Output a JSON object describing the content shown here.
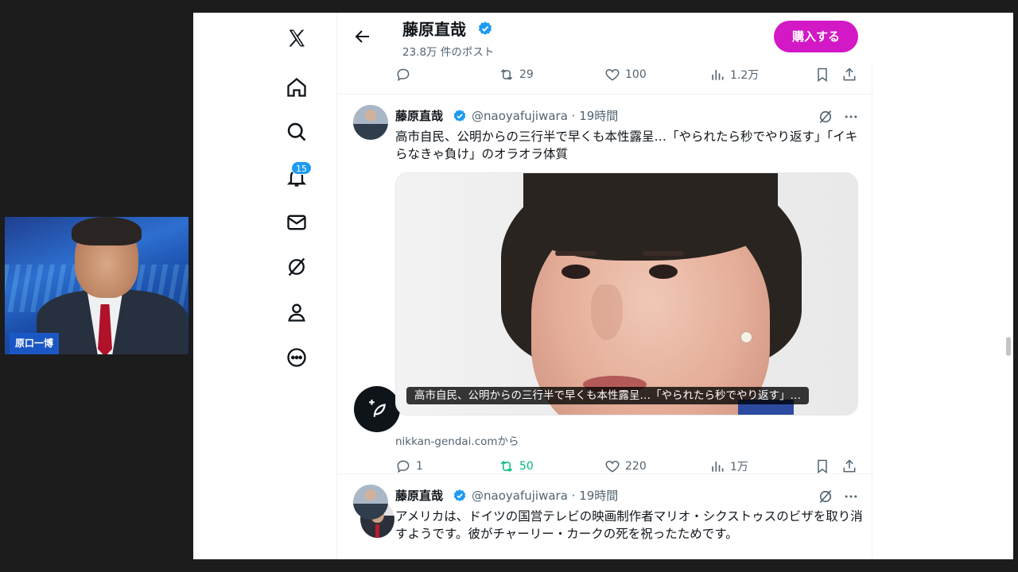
{
  "video_tile": {
    "name": "原口一博"
  },
  "nav": {
    "notification_count": "15"
  },
  "header": {
    "name": "藤原直哉",
    "post_count": "23.8万 件のポスト",
    "buy_label": "購入する"
  },
  "prev_tweet_actions": {
    "replies": "",
    "reposts": "29",
    "likes": "100",
    "views": "1.2万"
  },
  "tweets": [
    {
      "name": "藤原直哉",
      "handle": "@naoyafujiwara · 19時間",
      "text": "高市自民、公明からの三行半で早くも本性露呈…「やられたら秒でやり返す」「イキらなきゃ負け」のオラオラ体質",
      "card_caption": "高市自民、公明からの三行半で早くも本性露呈…「やられたら秒でやり返す」…",
      "source": "nikkan-gendai.comから",
      "replies": "1",
      "reposts": "50",
      "likes": "220",
      "views": "1万"
    },
    {
      "name": "藤原直哉",
      "handle": "@naoyafujiwara · 19時間",
      "text": "アメリカは、ドイツの国営テレビの映画制作者マリオ・シクストゥスのビザを取り消すようです。彼がチャーリー・カークの死を祝ったためです。"
    }
  ],
  "colors": {
    "accent": "#1d9bf0",
    "buy": "#d318c6",
    "repost_active": "#00ba7c",
    "text": "#0f1419",
    "muted": "#536471"
  }
}
